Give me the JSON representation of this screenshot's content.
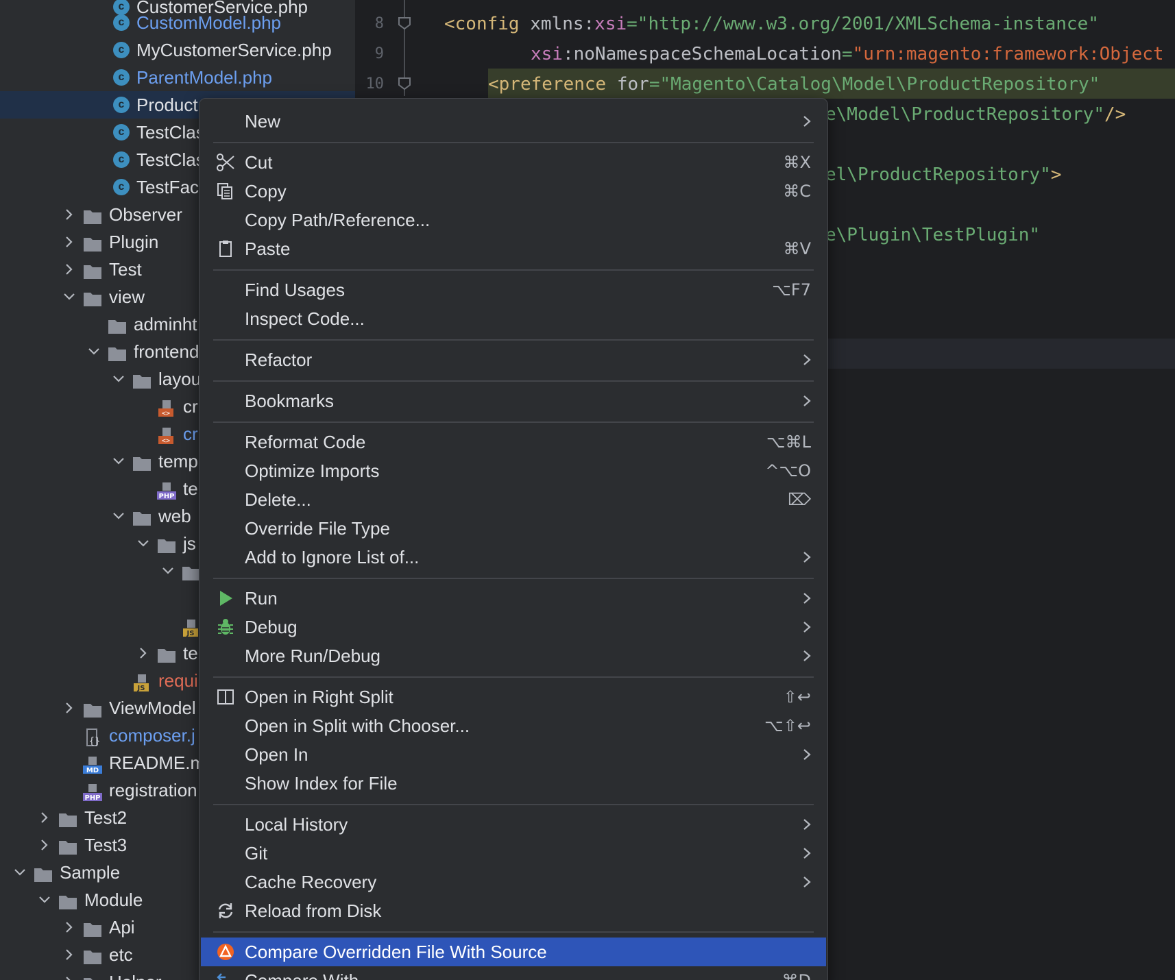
{
  "project_tree": {
    "items": [
      {
        "label": "CustomerService.php",
        "icon": "class-icon",
        "color": "default"
      },
      {
        "label": "CustomModel.php",
        "icon": "class-icon",
        "color": "blue"
      },
      {
        "label": "MyCustomerService.php",
        "icon": "class-icon",
        "color": "default"
      },
      {
        "label": "ParentModel.php",
        "icon": "class-icon",
        "color": "blue"
      },
      {
        "label": "Product",
        "icon": "class-icon",
        "color": "default",
        "selected": true
      },
      {
        "label": "TestClas",
        "icon": "class-icon",
        "color": "default"
      },
      {
        "label": "TestClas",
        "icon": "class-icon",
        "color": "default"
      },
      {
        "label": "TestFac",
        "icon": "class-icon",
        "color": "default"
      },
      {
        "label": "Observer",
        "icon": "folder-icon",
        "chevron": "right"
      },
      {
        "label": "Plugin",
        "icon": "folder-icon",
        "chevron": "right"
      },
      {
        "label": "Test",
        "icon": "folder-icon",
        "chevron": "right"
      },
      {
        "label": "view",
        "icon": "folder-icon",
        "chevron": "down"
      },
      {
        "label": "adminht",
        "icon": "folder-icon"
      },
      {
        "label": "frontend",
        "icon": "folder-icon",
        "chevron": "down"
      },
      {
        "label": "layou",
        "icon": "folder-icon",
        "chevron": "down"
      },
      {
        "label": "cr",
        "icon": "xml-file-icon"
      },
      {
        "label": "cr",
        "icon": "xml-file-icon",
        "color": "blue"
      },
      {
        "label": "temp",
        "icon": "folder-icon",
        "chevron": "down"
      },
      {
        "label": "te",
        "icon": "php-file-icon"
      },
      {
        "label": "web",
        "icon": "folder-icon",
        "chevron": "down"
      },
      {
        "label": "js",
        "icon": "folder-icon",
        "chevron": "down"
      },
      {
        "label": "",
        "icon": "folder-icon",
        "chevron": "down"
      },
      {
        "label": "",
        "icon": "js-file-icon"
      },
      {
        "label": "te",
        "icon": "folder-icon",
        "chevron": "right"
      },
      {
        "label": "requi",
        "icon": "js-file-icon",
        "color": "red"
      },
      {
        "label": "ViewModel",
        "icon": "folder-icon",
        "chevron": "right"
      },
      {
        "label": "composer.j",
        "icon": "json-file-icon",
        "color": "blue"
      },
      {
        "label": "README.m",
        "icon": "md-file-icon"
      },
      {
        "label": "registration",
        "icon": "php-file-icon"
      },
      {
        "label": "Test2",
        "icon": "folder-icon",
        "chevron": "right"
      },
      {
        "label": "Test3",
        "icon": "folder-icon",
        "chevron": "right"
      },
      {
        "label": "Sample",
        "icon": "folder-icon",
        "chevron": "down"
      },
      {
        "label": "Module",
        "icon": "folder-icon",
        "chevron": "down"
      },
      {
        "label": "Api",
        "icon": "folder-icon",
        "chevron": "right"
      },
      {
        "label": "etc",
        "icon": "folder-icon",
        "chevron": "right"
      },
      {
        "label": "Helper",
        "icon": "folder-icon",
        "chevron": "right"
      }
    ]
  },
  "editor": {
    "line_numbers": [
      "8",
      "9",
      "10"
    ],
    "line8": {
      "tag": "<config",
      "sp": " ",
      "attr": "xmlns",
      "colon": ":",
      "ns": "xsi",
      "eq": "=",
      "str": "\"http://www.w3.org/2001/XMLSchema-instance\""
    },
    "line9": {
      "ns": "xsi",
      "colon": ":",
      "attr": "noNamespaceSchemaLocation",
      "eq": "=",
      "str": "\"urn:magento:framework:Object"
    },
    "line10": {
      "tag": "<preference",
      "sp": " ",
      "attr": "for",
      "eq": "=",
      "str": "\"Magento\\Catalog\\Model\\ProductRepository\""
    },
    "line11": {
      "str": "e\\Model\\ProductRepository\"",
      "tag": "/>"
    },
    "line13": {
      "str": "el\\ProductRepository\"",
      "tag": ">"
    },
    "line15": {
      "str": "e\\Plugin\\TestPlugin\""
    }
  },
  "context_menu": {
    "new": {
      "label": "New"
    },
    "cut": {
      "label": "Cut",
      "shortcut": "⌘X",
      "icon": "scissors-icon"
    },
    "copy": {
      "label": "Copy",
      "shortcut": "⌘C",
      "icon": "copy-icon"
    },
    "copy_path": {
      "label": "Copy Path/Reference..."
    },
    "paste": {
      "label": "Paste",
      "shortcut": "⌘V",
      "icon": "clipboard-icon"
    },
    "find_usages": {
      "label": "Find Usages",
      "shortcut": "⌥F7"
    },
    "inspect_code": {
      "label": "Inspect Code..."
    },
    "refactor": {
      "label": "Refactor"
    },
    "bookmarks": {
      "label": "Bookmarks"
    },
    "reformat": {
      "label": "Reformat Code",
      "shortcut": "⌥⌘L"
    },
    "optimize": {
      "label": "Optimize Imports",
      "shortcut": "^⌥O"
    },
    "delete": {
      "label": "Delete...",
      "shortcut": "⌦"
    },
    "override_type": {
      "label": "Override File Type"
    },
    "ignore_list": {
      "label": "Add to Ignore List of..."
    },
    "run": {
      "label": "Run",
      "icon": "run-icon"
    },
    "debug": {
      "label": "Debug",
      "icon": "bug-icon"
    },
    "more_run": {
      "label": "More Run/Debug"
    },
    "open_right": {
      "label": "Open in Right Split",
      "shortcut": "⇧↩",
      "icon": "split-icon"
    },
    "open_chooser": {
      "label": "Open in Split with Chooser...",
      "shortcut": "⌥⇧↩"
    },
    "open_in": {
      "label": "Open In"
    },
    "show_index": {
      "label": "Show Index for File"
    },
    "local_history": {
      "label": "Local History"
    },
    "git": {
      "label": "Git"
    },
    "cache_recovery": {
      "label": "Cache Recovery"
    },
    "reload": {
      "label": "Reload from Disk",
      "icon": "reload-icon"
    },
    "compare_overridden": {
      "label": "Compare Overridden File With Source",
      "icon": "magento-icon"
    },
    "compare_with": {
      "label": "Compare With...",
      "shortcut": "⌘D",
      "icon": "compare-icon"
    }
  },
  "colors": {
    "selection": "#2e55b8",
    "menu_bg": "#2b2d30",
    "editor_bg": "#1e1f22",
    "tree_selected": "#203048",
    "string": "#6aab73",
    "tag": "#d5b778",
    "namespace": "#c77dbb"
  }
}
